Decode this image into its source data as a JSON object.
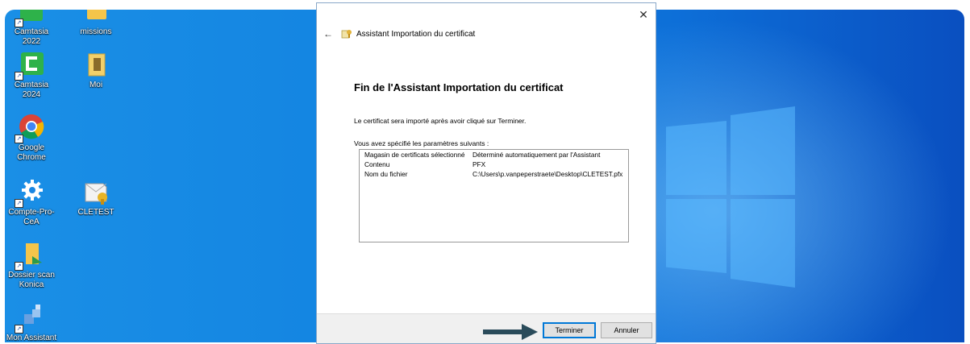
{
  "desktop": {
    "icons": [
      {
        "label": "Camtasia 2022"
      },
      {
        "label": "missions"
      },
      {
        "label": "Camtasia 2024"
      },
      {
        "label": "Moi"
      },
      {
        "label": "Google Chrome"
      },
      {
        "label": "Compte-Pro-CeA"
      },
      {
        "label": "CLETEST"
      },
      {
        "label": "Dossier scan Konica"
      },
      {
        "label": "Mon Assistant"
      }
    ]
  },
  "dialog": {
    "close_glyph": "✕",
    "back_glyph": "←",
    "title": "Assistant Importation du certificat",
    "heading": "Fin de l'Assistant Importation du certificat",
    "description": "Le certificat sera importé après avoir cliqué sur Terminer.",
    "params_label": "Vous avez spécifié les paramètres suivants :",
    "params": [
      {
        "key": "Magasin de certificats sélectionné",
        "value": "Déterminé automatiquement par l'Assistant"
      },
      {
        "key": "Contenu",
        "value": "PFX"
      },
      {
        "key": "Nom du fichier",
        "value": "C:\\Users\\p.vanpeperstraete\\Desktop\\CLETEST.pfx"
      }
    ],
    "finish_label": "Terminer",
    "cancel_label": "Annuler"
  },
  "colors": {
    "desktop_blue": "#1282e0",
    "arrow": "#2a4b5a",
    "accent": "#0078d7"
  }
}
